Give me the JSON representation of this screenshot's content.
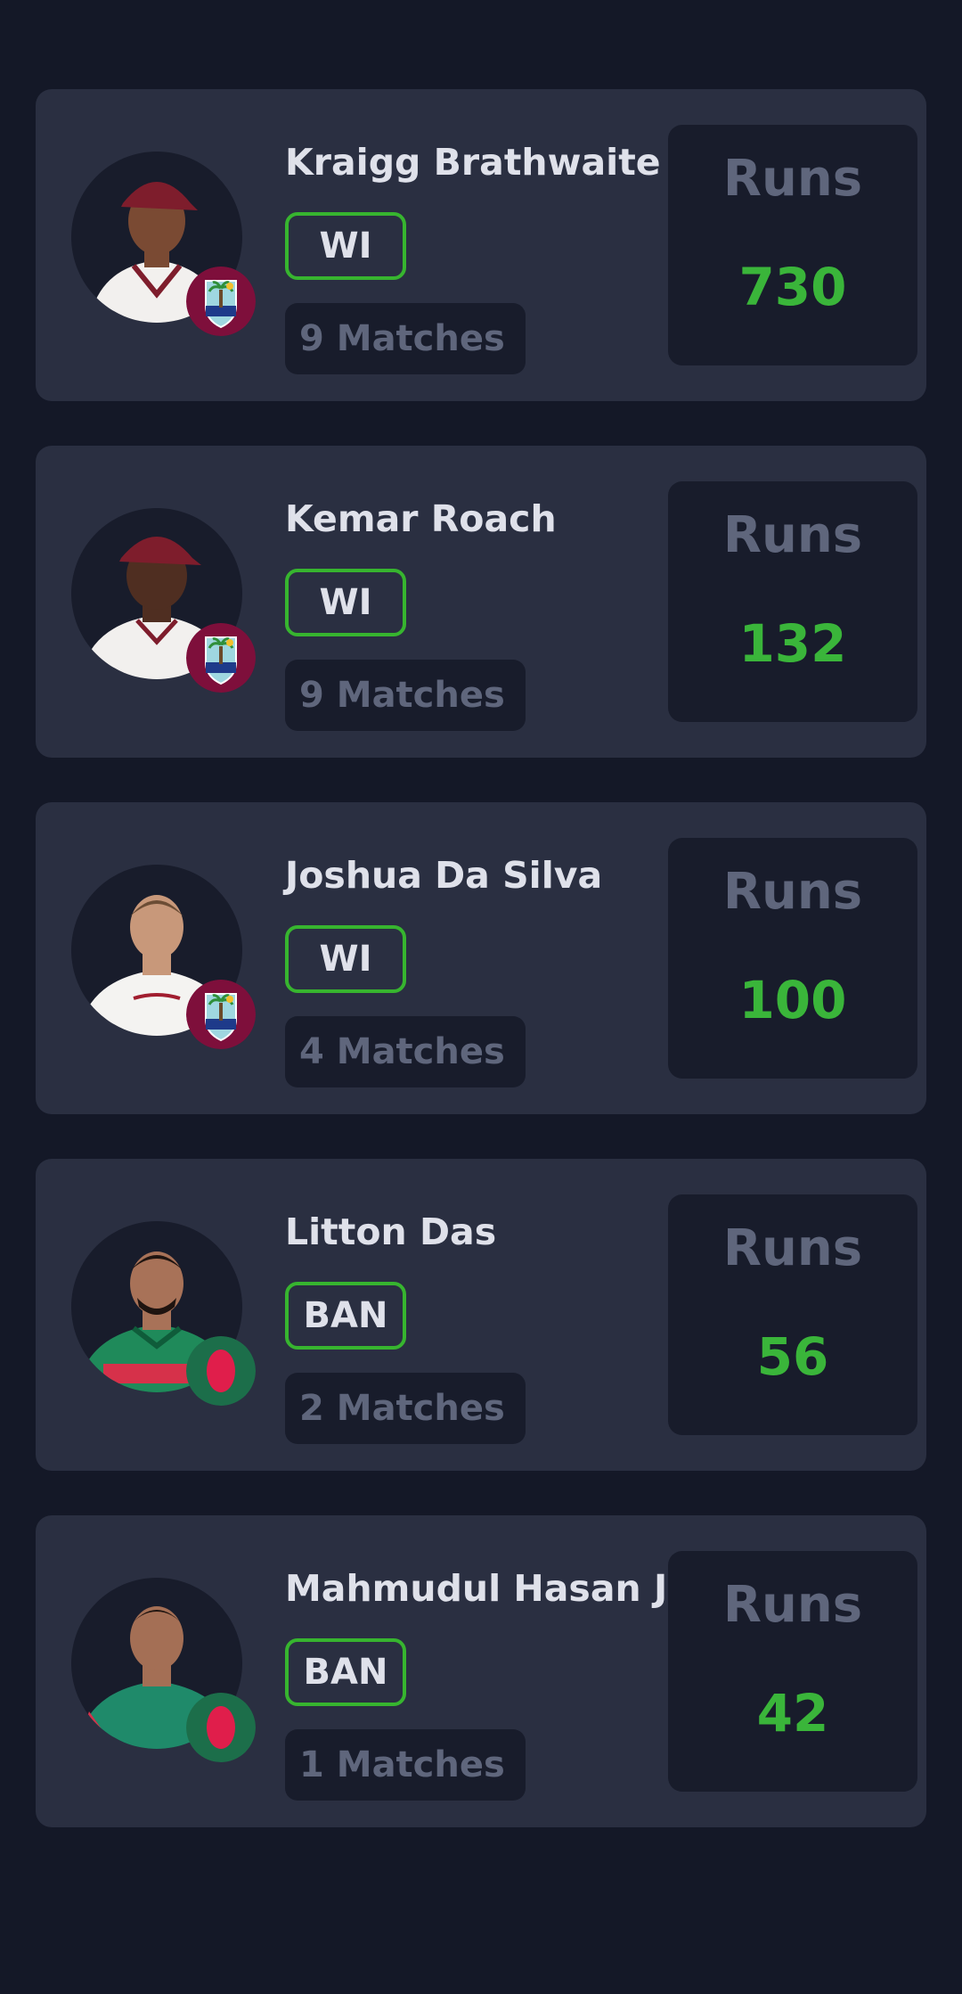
{
  "players": [
    {
      "name": "Kraigg Brathwaite",
      "team": "WI",
      "matches": "9 Matches",
      "stat_label": "Runs",
      "stat_value": "730",
      "flag": "west-indies-crest-icon",
      "jersey_color": "#f2f0ee",
      "cap_color": "#7e1d2c",
      "skin_color": "#7a4a33"
    },
    {
      "name": "Kemar Roach",
      "team": "WI",
      "matches": "9 Matches",
      "stat_label": "Runs",
      "stat_value": "132",
      "flag": "west-indies-crest-icon",
      "jersey_color": "#f2f0ee",
      "cap_color": "#7e1d2c",
      "skin_color": "#4f2e21"
    },
    {
      "name": "Joshua Da Silva",
      "team": "WI",
      "matches": "4 Matches",
      "stat_label": "Runs",
      "stat_value": "100",
      "flag": "west-indies-crest-icon",
      "jersey_color": "#f4f3f1",
      "cap_color": "#6c4d35",
      "skin_color": "#c8987a"
    },
    {
      "name": "Litton Das",
      "team": "BAN",
      "matches": "2 Matches",
      "stat_label": "Runs",
      "stat_value": "56",
      "flag": "bangladesh-flag-icon",
      "jersey_color": "#1f8a5a",
      "cap_color": "#1f1410",
      "skin_color": "#a87258"
    },
    {
      "name": "Mahmudul Hasan Joy",
      "team": "BAN",
      "matches": "1 Matches",
      "stat_label": "Runs",
      "stat_value": "42",
      "flag": "bangladesh-flag-icon",
      "jersey_color": "#1f8a6a",
      "cap_color": "#1f1410",
      "skin_color": "#a46f55"
    }
  ],
  "colors": {
    "background": "#141827",
    "card": "#2a2f41",
    "panel": "#181c2b",
    "accent_green": "#37b52f",
    "muted_text": "#5f667c",
    "primary_text": "#dfe1ea"
  }
}
